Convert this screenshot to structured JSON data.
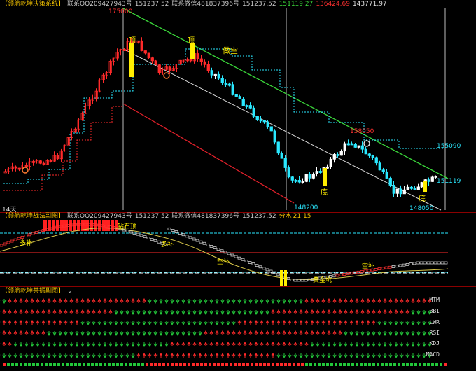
{
  "main": {
    "title": "【领航乾坤决策系统】",
    "contact_qq_label": "联系QQ",
    "contact_qq": "209427943号",
    "v1": "151237.52",
    "contact_wx_label": "联系微信",
    "contact_wx": "481837396号",
    "v2": "151237.52",
    "v3": "151119.27",
    "v4": "136424.69",
    "v5": "143771.97",
    "period_label": "14天",
    "high_label": "175000",
    "low_label": "148200",
    "low2_label": "148050",
    "mid_label": "158050",
    "right_price_1": "155090",
    "right_price_2": "151119",
    "trend_text": "做空",
    "top_marks": [
      "顶",
      "顶"
    ],
    "bottom_marks": [
      "底",
      "底"
    ]
  },
  "pane2": {
    "title": "【领航乾坤战法副图】",
    "contact_qq_label": "联系QQ",
    "contact_qq": "209427943号",
    "v1": "151237.52",
    "contact_wx_label": "联系微信",
    "contact_wx": "481837396号",
    "v2": "151237.52",
    "score_label": "分水",
    "score": "21.15",
    "labels": {
      "duo_bu_1": "多补",
      "diamond_top": "钻石顶",
      "duo_bu_2": "多补",
      "kong_bu": "空补",
      "gold_pit": "黄金坑",
      "kong_bu_2": "空补"
    }
  },
  "pane3": {
    "title": "【领航乾坤共振副图】",
    "indicators": [
      "MTM",
      "BBI",
      "LWR",
      "RSI",
      "KDJ",
      "MACD"
    ]
  },
  "colors": {
    "up": "#ff2a2a",
    "down": "#2ae8ff",
    "trend_green": "#3ad63a",
    "trend_red": "#e0202a",
    "yellow_bar": "#ffee00",
    "text_yellow": "#ffee00"
  }
}
